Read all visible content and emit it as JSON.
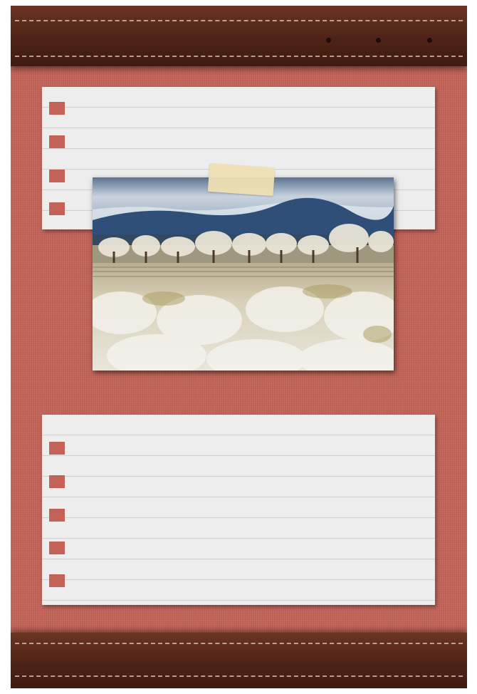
{
  "theme": {
    "background": "#c46257",
    "leather": "#5b2a1c",
    "paper": "#ededed",
    "tape": "#efe0b4"
  },
  "photo": {
    "subject": "blossoming-orchard-photo"
  }
}
